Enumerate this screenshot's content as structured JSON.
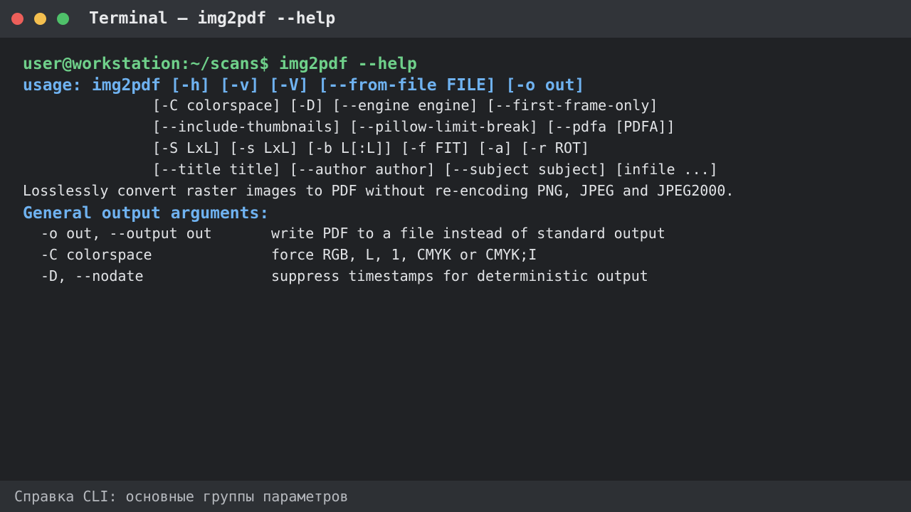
{
  "window": {
    "title": "Terminal — img2pdf --help"
  },
  "terminal": {
    "prompt_line": "user@workstation:~/scans$ img2pdf --help",
    "usage_line": "usage: img2pdf [-h] [-v] [-V] [--from-file FILE] [-o out]",
    "usage_continuation": [
      "[-C colorspace] [-D] [--engine engine] [--first-frame-only]",
      "[--include-thumbnails] [--pillow-limit-break] [--pdfa [PDFA]]",
      "[-S LxL] [-s LxL] [-b L[:L]] [-f FIT] [-a] [-r ROT]",
      "[--title title] [--author author] [--subject subject] [infile ...]"
    ],
    "description": "Losslessly convert raster images to PDF without re-encoding PNG, JPEG and JPEG2000.",
    "section_heading": "General output arguments:",
    "options": [
      {
        "flag": "-o out, --output out",
        "desc": "write PDF to a file instead of standard output"
      },
      {
        "flag": "-C colorspace",
        "desc": "force RGB, L, 1, CMYK or CMYK;I"
      },
      {
        "flag": "-D, --nodate",
        "desc": "suppress timestamps for deterministic output"
      }
    ]
  },
  "statusbar": {
    "text": "Справка CLI: основные группы параметров"
  },
  "colors": {
    "background": "#202225",
    "titlebar": "#313439",
    "statusbar": "#2d3034",
    "prompt_green": "#6fd08a",
    "usage_blue": "#6fb2f0",
    "text": "#e1e3e6",
    "close": "#ed5f5a",
    "minimize": "#f4bf4f",
    "maximize": "#4fc16a"
  }
}
